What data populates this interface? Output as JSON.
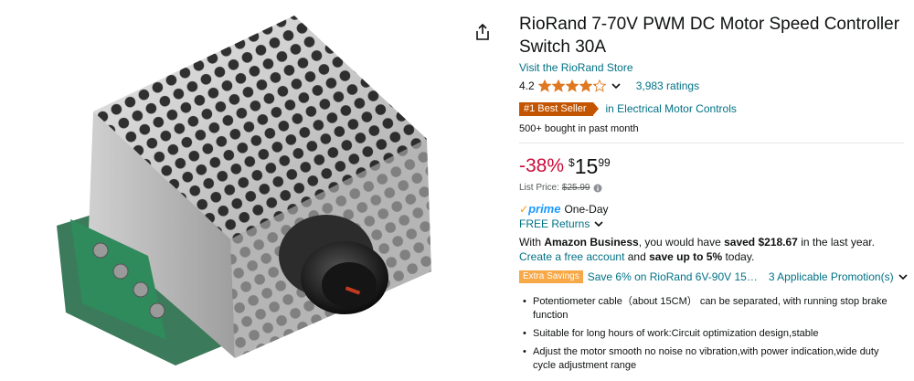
{
  "product": {
    "title": "RioRand 7-70V PWM DC Motor Speed Controller Switch 30A",
    "store_link": "Visit the RioRand Store",
    "rating_value": "4.2",
    "rating_stars": 4.2,
    "rating_count": "3,983 ratings",
    "best_seller_badge": "#1 Best Seller",
    "best_seller_category": "in Electrical Motor Controls",
    "bought_text": "500+ bought in past month",
    "discount": "-38%",
    "price_symbol": "$",
    "price_whole": "15",
    "price_fraction": "99",
    "list_price_label": "List Price:",
    "list_price_value": "$25.99",
    "prime_check": "✓",
    "prime_word": "prime",
    "prime_delivery": "One-Day",
    "free_returns": "FREE Returns",
    "business_pre": "With ",
    "business_bold": "Amazon Business",
    "business_mid": ", you would have ",
    "business_saved": "saved $218.67",
    "business_post": " in the last year. ",
    "business_link": "Create a free account",
    "business_and": " and ",
    "business_save": "save up to 5%",
    "business_end": " today.",
    "extra_savings_badge": "Extra Savings",
    "extra_savings_text": "Save 6% on RioRand 6V-90V 15…",
    "promotions_link": "3 Applicable Promotion(s)",
    "bullets": [
      "Potentiometer cable（about 15CM） can be separated, with running stop brake function",
      "Suitable for long hours of work:Circuit optimization design,stable",
      "Adjust the motor smooth no noise no vibration,with power indication,wide duty cycle adjustment range"
    ]
  },
  "colors": {
    "link": "#007185",
    "deal_red": "#cc0c39",
    "star": "#de7921",
    "best_seller": "#c45500",
    "extra_savings": "#f7a847",
    "prime_blue": "#1a98ff"
  },
  "icons": [
    "share-icon",
    "star-icon",
    "chevron-down-icon",
    "info-icon"
  ]
}
